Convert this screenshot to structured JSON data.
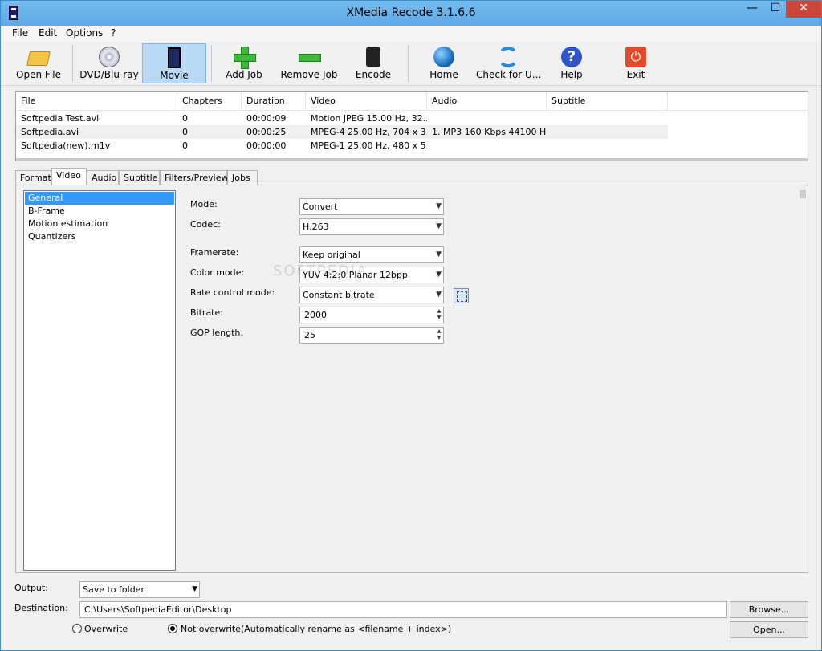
{
  "window": {
    "title": "XMedia Recode 3.1.6.6",
    "min_glyph": "—",
    "max_glyph": "☐",
    "close_glyph": "✕"
  },
  "menu": [
    "File",
    "Edit",
    "Options",
    "?"
  ],
  "toolbar": {
    "open_file": "Open File",
    "dvd": "DVD/Blu-ray",
    "movie": "Movie",
    "add_job": "Add Job",
    "remove_job": "Remove Job",
    "encode": "Encode",
    "home": "Home",
    "check_updates": "Check for U...",
    "help": "Help",
    "exit": "Exit"
  },
  "file_list": {
    "columns": [
      "File",
      "Chapters",
      "Duration",
      "Video",
      "Audio",
      "Subtitle"
    ],
    "rows": [
      [
        "Softpedia Test.avi",
        "0",
        "00:00:09",
        "Motion JPEG 15.00 Hz, 32...",
        "",
        ""
      ],
      [
        "Softpedia.avi",
        "0",
        "00:00:25",
        "MPEG-4 25.00 Hz, 704 x 3...",
        "1. MP3 160 Kbps 44100 H...",
        ""
      ],
      [
        "Softpedia(new).m1v",
        "0",
        "00:00:00",
        "MPEG-1 25.00 Hz, 480 x 5...",
        "",
        ""
      ]
    ]
  },
  "tabs": [
    "Format",
    "Video",
    "Audio",
    "Subtitle",
    "Filters/Preview",
    "Jobs"
  ],
  "active_tab": "Video",
  "video_nav": [
    "General",
    "B-Frame",
    "Motion estimation",
    "Quantizers"
  ],
  "settings": {
    "mode_label": "Mode:",
    "mode_value": "Convert",
    "codec_label": "Codec:",
    "codec_value": "H.263",
    "framerate_label": "Framerate:",
    "framerate_value": "Keep original",
    "color_label": "Color mode:",
    "color_value": "YUV 4:2:0 Planar 12bpp",
    "rate_label": "Rate control mode:",
    "rate_value": "Constant bitrate",
    "bitrate_label": "Bitrate:",
    "bitrate_value": "2000",
    "gop_label": "GOP length:",
    "gop_value": "25"
  },
  "watermark": "SOFTPEDIA",
  "output": {
    "output_label": "Output:",
    "output_value": "Save to folder",
    "destination_label": "Destination:",
    "destination_value": "C:\\Users\\SoftpediaEditor\\Desktop",
    "browse": "Browse...",
    "open": "Open...",
    "overwrite": "Overwrite",
    "not_overwrite": "Not overwrite(Automatically rename as <filename + index>)"
  }
}
